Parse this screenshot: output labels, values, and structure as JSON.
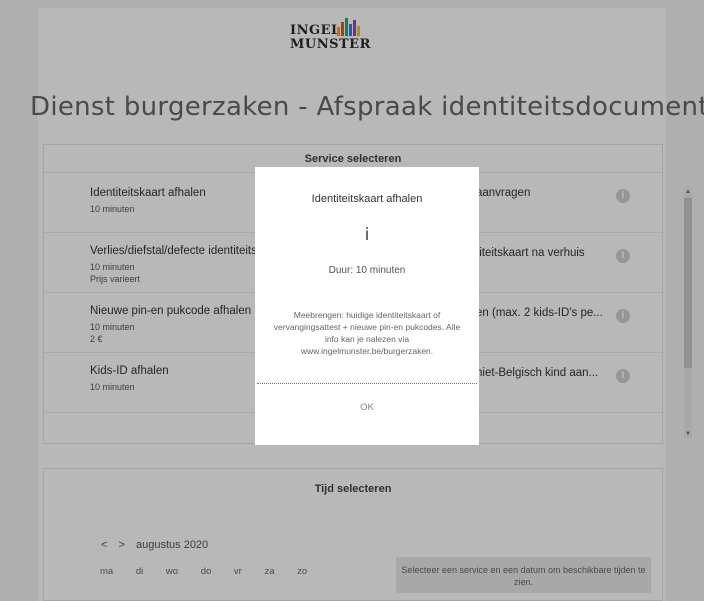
{
  "logo": {
    "line1": "INGEL",
    "line2": "MUNSTER",
    "bar_colors": [
      "#f2a33a",
      "#e4572e",
      "#2aa876",
      "#3b7dd8",
      "#8c4bb5",
      "#f2c230"
    ]
  },
  "page_title": "Dienst burgerzaken - Afspraak identiteitsdocument",
  "service_section": {
    "header": "Service selecteren",
    "services": [
      {
        "title": "Identiteitskaart afhalen",
        "sub": [
          "10 minuten"
        ]
      },
      {
        "title": "aanvragen",
        "sub": []
      },
      {
        "title": "Verlies/diefstal/defecte identiteitskaart",
        "sub": [
          "10 minuten",
          "Prijs varieert"
        ]
      },
      {
        "title": "titeitskaart na verhuis",
        "sub": []
      },
      {
        "title": "Nieuwe pin-en pukcode afhalen",
        "sub": [
          "10 minuten",
          "2 €"
        ]
      },
      {
        "title": "en (max. 2 kids-ID's pe...",
        "sub": []
      },
      {
        "title": "Kids-ID afhalen",
        "sub": [
          "10 minuten"
        ]
      },
      {
        "title": "niet-Belgisch kind aan...",
        "sub": []
      }
    ],
    "info_icon_glyph": "i"
  },
  "time_section": {
    "header": "Tijd selecteren",
    "prev_label": "<",
    "next_label": ">",
    "month": "augustus 2020",
    "weekdays": [
      "ma",
      "di",
      "wo",
      "do",
      "vr",
      "za",
      "zo"
    ],
    "hint": "Selecteer een service en een datum om beschikbare tijden te zien."
  },
  "modal": {
    "title": "Identiteitskaart afhalen",
    "icon_glyph": "i",
    "duration": "Duur: 10 minuten",
    "description": "Meebrengen: huidige identiteitskaart of vervangingsattest + nieuwe pin-en pukcodes. Alle info kan je nalezen via www.ingelmunster.be/burgerzaken.",
    "ok_label": "OK"
  }
}
